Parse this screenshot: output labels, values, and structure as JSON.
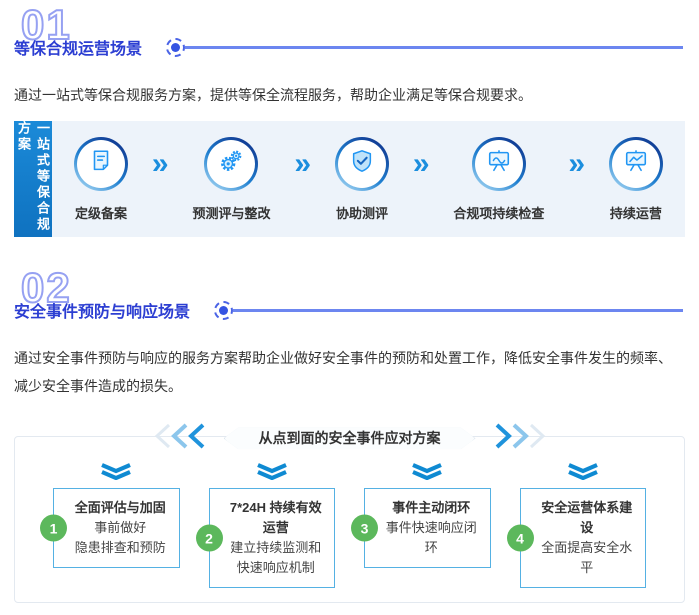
{
  "colors": {
    "heading_blue": "#2c3ed2",
    "number_outline": "#96a1f2",
    "deco_line": "#6c86f0",
    "flow_tab_blue": "#1580cf",
    "flow_bg": "#edf3fa",
    "icon_blue": "#2196f3",
    "card_border_blue": "#55b1e3",
    "step_green": "#5cb85c"
  },
  "sections": {
    "compliance": {
      "number": "01",
      "title": "等保合规运营场景",
      "description": "通过一站式等保合规服务方案，提供等保全流程服务，帮助企业满足等保合规要求。",
      "flow": {
        "side_label": "一站式等保合规方案",
        "chevron": "»",
        "steps": [
          {
            "icon": "document-icon",
            "label": "定级备案"
          },
          {
            "icon": "gears-icon",
            "label": "预测评与整改"
          },
          {
            "icon": "shield-check-icon",
            "label": "协助测评"
          },
          {
            "icon": "chart-board-wave-icon",
            "label": "合规项持续检查"
          },
          {
            "icon": "chart-board-line-icon",
            "label": "持续运营"
          }
        ]
      }
    },
    "incident": {
      "number": "02",
      "title": "安全事件预防与响应场景",
      "description": "通过安全事件预防与响应的服务方案帮助企业做好安全事件的预防和处置工作，降低安全事件发生的频率、减少安全事件造成的损失。",
      "plan": {
        "header": "从点到面的安全事件应对方案",
        "items": [
          {
            "num": "1",
            "title": "全面评估与加固",
            "lines": [
              "事前做好",
              "隐患排查和预防"
            ]
          },
          {
            "num": "2",
            "title": "7*24H 持续有效运营",
            "lines": [
              "建立持续监测和",
              "快速响应机制"
            ]
          },
          {
            "num": "3",
            "title": "事件主动闭环",
            "lines": [
              "事件快速响应闭环"
            ]
          },
          {
            "num": "4",
            "title": "安全运营体系建设",
            "lines": [
              "全面提高安全水平"
            ]
          }
        ]
      }
    }
  }
}
